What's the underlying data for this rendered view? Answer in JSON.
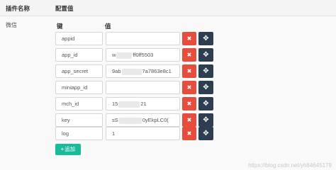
{
  "header": {
    "col_plugin_name": "插件名称",
    "col_config_value": "配置值"
  },
  "plugin": {
    "name": "微信",
    "key_header": "键",
    "value_header": "值"
  },
  "rows": [
    {
      "key": "appid",
      "value_a": "",
      "value_b": ""
    },
    {
      "key": "app_id",
      "value_a": "w",
      "value_b": "ff0ff5503"
    },
    {
      "key": "app_secret",
      "value_a": "9ab",
      "value_b": "7a7863e8c1"
    },
    {
      "key": "miniapp_id",
      "value_a": "",
      "value_b": ""
    },
    {
      "key": "mch_id",
      "value_a": "15",
      "value_b": "21"
    },
    {
      "key": "key",
      "value_a": "sS",
      "value_b": "0yEkpLC0("
    },
    {
      "key": "log",
      "value_a": "1",
      "value_b": ""
    }
  ],
  "buttons": {
    "delete_glyph": "✖",
    "move_glyph": "✥",
    "add_plus": "+",
    "add_label": "追加"
  },
  "colors": {
    "delete": "#e74c3c",
    "move": "#2c3e50",
    "add": "#18bc9c"
  },
  "watermark": "https://blog.csdn.net/yh84645179"
}
